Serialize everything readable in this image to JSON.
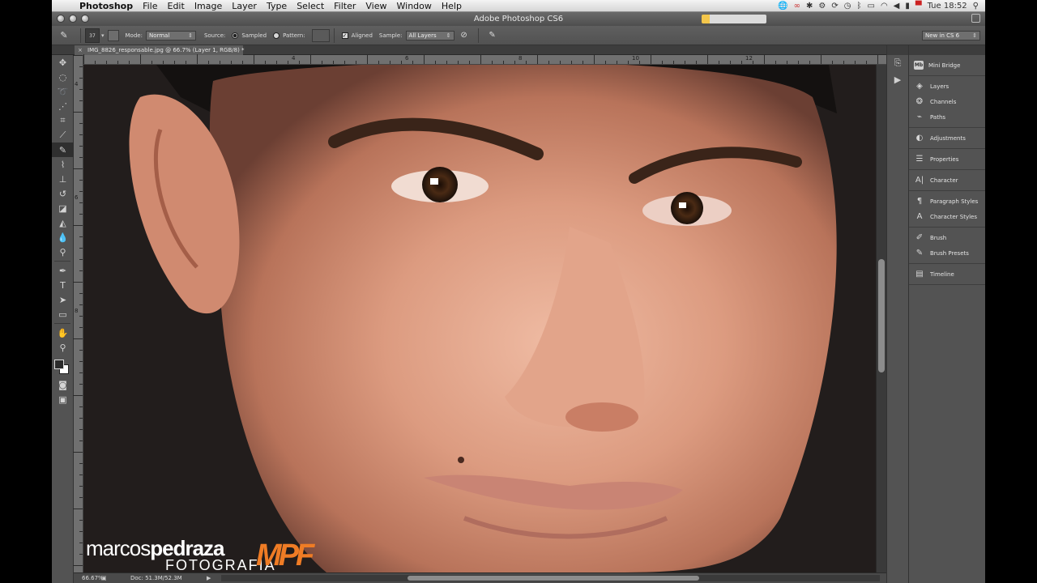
{
  "menubar": {
    "app_name": "Photoshop",
    "menus": [
      "File",
      "Edit",
      "Image",
      "Layer",
      "Type",
      "Select",
      "Filter",
      "View",
      "Window",
      "Help"
    ],
    "clock": "Tue 18:52"
  },
  "window": {
    "title": "Adobe Photoshop CS6"
  },
  "options": {
    "brush_size": "37",
    "mode_label": "Mode:",
    "mode_value": "Normal",
    "source_label": "Source:",
    "sampled_label": "Sampled",
    "pattern_label": "Pattern:",
    "aligned_label": "Aligned",
    "sample_label": "Sample:",
    "sample_value": "All Layers",
    "workspace_value": "New in CS 6"
  },
  "document": {
    "tab_title": "IMG_8826_responsable.jpg @ 66.7% (Layer 1, RGB/8) *",
    "zoom": "66.67%",
    "doc_size": "Doc: 51.3M/52.3M"
  },
  "rulers": {
    "h_labels": [
      "4",
      "6",
      "8",
      "10",
      "12"
    ],
    "v_labels": [
      "4",
      "6",
      "8"
    ]
  },
  "watermark": {
    "line1_a": "marcos",
    "line1_b": "pedraza",
    "line2": "FOTOGRAFIA",
    "logo": "MPF"
  },
  "panels": {
    "groups": [
      [
        {
          "icon": "Mb",
          "label": "Mini Bridge"
        }
      ],
      [
        {
          "icon": "layers-icon",
          "label": "Layers"
        },
        {
          "icon": "channels-icon",
          "label": "Channels"
        },
        {
          "icon": "paths-icon",
          "label": "Paths"
        }
      ],
      [
        {
          "icon": "adjustments-icon",
          "label": "Adjustments"
        }
      ],
      [
        {
          "icon": "properties-icon",
          "label": "Properties"
        }
      ],
      [
        {
          "icon": "character-icon",
          "label": "Character"
        }
      ],
      [
        {
          "icon": "paragraph-styles-icon",
          "label": "Paragraph Styles"
        },
        {
          "icon": "character-styles-icon",
          "label": "Character Styles"
        }
      ],
      [
        {
          "icon": "brush-icon",
          "label": "Brush"
        },
        {
          "icon": "brush-presets-icon",
          "label": "Brush Presets"
        }
      ],
      [
        {
          "icon": "timeline-icon",
          "label": "Timeline"
        }
      ]
    ]
  },
  "colors": {
    "accent_logo": "#ef7c25",
    "ui_dark": "#535353"
  }
}
